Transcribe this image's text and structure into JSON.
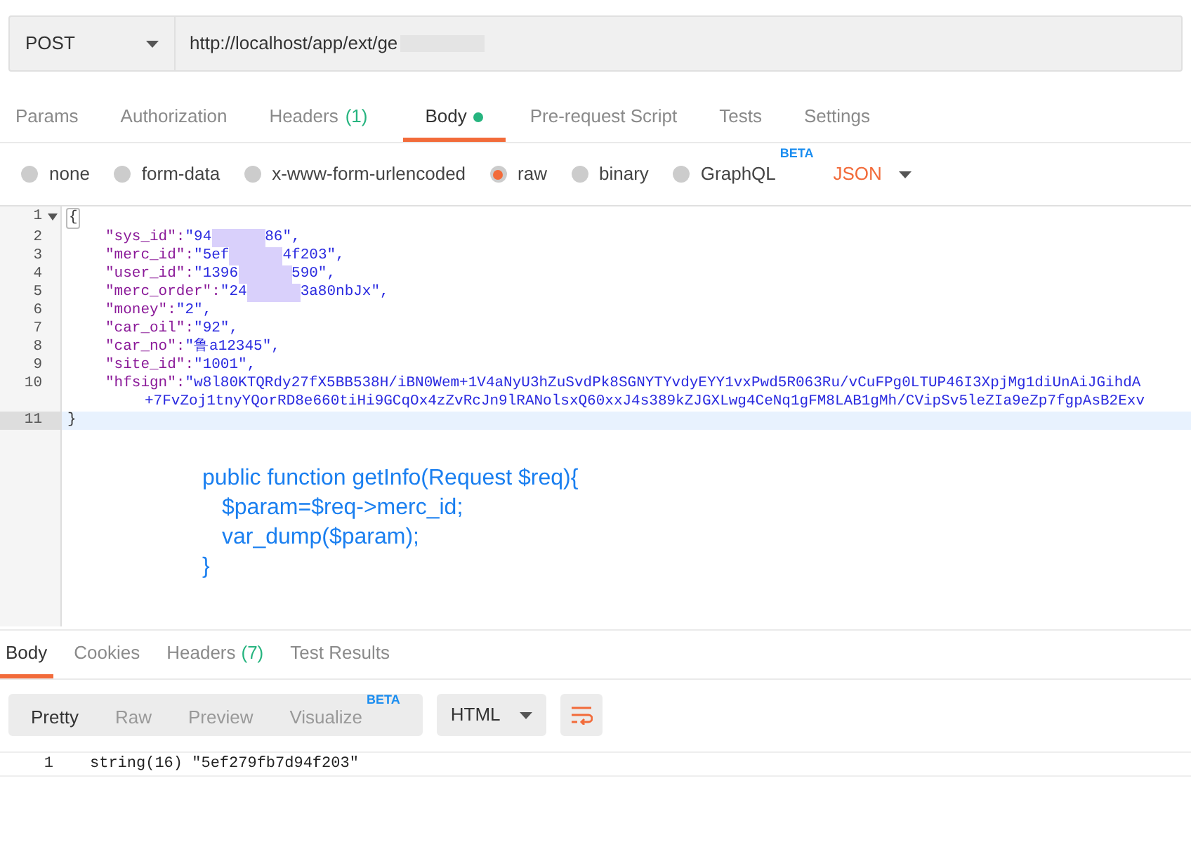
{
  "request": {
    "method": "POST",
    "url": "http://localhost/app/ext/ge"
  },
  "request_tabs": [
    {
      "label": "Params",
      "dot": false,
      "selected": false
    },
    {
      "label": "Authorization",
      "dot": false,
      "selected": false
    },
    {
      "label": "Headers",
      "count": "(1)",
      "dot": false,
      "selected": false
    },
    {
      "label": "Body",
      "dot": true,
      "selected": true
    },
    {
      "label": "Pre-request Script",
      "dot": false,
      "selected": false
    },
    {
      "label": "Tests",
      "dot": false,
      "selected": false
    },
    {
      "label": "Settings",
      "dot": false,
      "selected": false
    }
  ],
  "body_types": [
    {
      "label": "none",
      "selected": false
    },
    {
      "label": "form-data",
      "selected": false
    },
    {
      "label": "x-www-form-urlencoded",
      "selected": false
    },
    {
      "label": "raw",
      "selected": true
    },
    {
      "label": "binary",
      "selected": false
    },
    {
      "label": "GraphQL",
      "selected": false,
      "badge": "BETA"
    }
  ],
  "raw_format": "JSON",
  "editor_lines": [
    {
      "number": "1",
      "kind": "open_brace",
      "text": "{",
      "current": false
    },
    {
      "number": "2",
      "kind": "pair",
      "key": "\"sys_id\":",
      "value": "\"94",
      "tail": "86\",",
      "current": false
    },
    {
      "number": "3",
      "kind": "pair",
      "key": "\"merc_id\":",
      "value": "\"5ef",
      "tail": "4f203\",",
      "current": false
    },
    {
      "number": "4",
      "kind": "pair",
      "key": "\"user_id\":",
      "value": "\"1396",
      "tail": "590\",",
      "current": false
    },
    {
      "number": "5",
      "kind": "pair",
      "key": "\"merc_order\":",
      "value": "\"24",
      "tail": "3a80nbJx\",",
      "current": false
    },
    {
      "number": "6",
      "kind": "pair",
      "key": "\"money\":",
      "value": "\"2\",",
      "current": false
    },
    {
      "number": "7",
      "kind": "pair",
      "key": "\"car_oil\":",
      "value": "\"92\",",
      "current": false
    },
    {
      "number": "8",
      "kind": "pair",
      "key": "\"car_no\":",
      "value": "\"鲁a12345\",",
      "current": false
    },
    {
      "number": "9",
      "kind": "pair",
      "key": "\"site_id\":",
      "value": "\"1001\",",
      "current": false
    },
    {
      "number": "10",
      "kind": "pair",
      "key": "\"hfsign\":",
      "value": "\"w8l80KTQRdy27fX5BB538H/iBN0Wem+1V4aNyU3hZuSvdPk8SGNYTYvdyEYY1vxPwd5R063Ru/vCuFPg0LTUP46I3XpjMg1diUnAiJGihdA",
      "wrap": "+7FvZoj1tnyYQorRD8e660tiHi9GCqOx4zZvRcJn9lRANolsxQ60xxJ4s389kZJGXLwg4CeNq1gFM8LAB1gMh/CVipSv5leZIa9eZp7fgpAsB2Exv",
      "current": false
    },
    {
      "number": "11",
      "kind": "close_brace",
      "text": "}",
      "current": true
    }
  ],
  "annotation": [
    "public function getInfo(Request $req){",
    "$param=$req->merc_id;",
    "var_dump($param);",
    "}"
  ],
  "response_tabs": [
    {
      "label": "Body",
      "selected": true
    },
    {
      "label": "Cookies",
      "selected": false
    },
    {
      "label": "Headers",
      "count": "(7)",
      "selected": false
    },
    {
      "label": "Test Results",
      "selected": false
    }
  ],
  "view_modes": [
    {
      "label": "Pretty",
      "selected": true
    },
    {
      "label": "Raw",
      "selected": false
    },
    {
      "label": "Preview",
      "selected": false
    },
    {
      "label": "Visualize",
      "selected": false,
      "badge": "BETA"
    }
  ],
  "response_format": "HTML",
  "response_lines": [
    {
      "number": "1",
      "text": "string(16) \"5ef279fb7d94f203\""
    }
  ]
}
